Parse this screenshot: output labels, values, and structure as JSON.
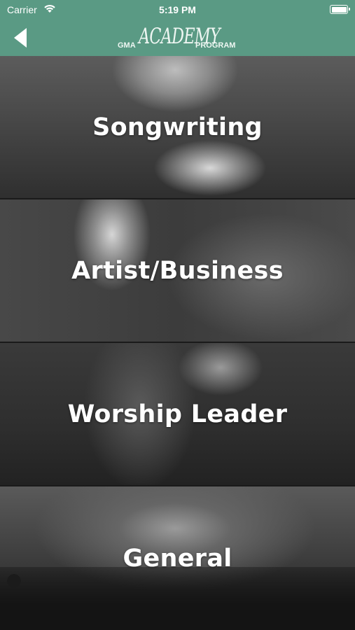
{
  "status_bar": {
    "carrier": "Carrier",
    "time": "5:19 PM"
  },
  "nav": {
    "logo": {
      "prefix": "GMA",
      "main": "ACADEMY",
      "suffix": "PROGRAM"
    }
  },
  "categories": [
    {
      "label": "Songwriting"
    },
    {
      "label": "Artist/Business"
    },
    {
      "label": "Worship Leader"
    },
    {
      "label": "General"
    }
  ],
  "colors": {
    "nav_background": "#5a9a84",
    "text": "#ffffff"
  },
  "icons": {
    "back": "back-arrow-icon",
    "wifi": "wifi-icon",
    "battery": "battery-icon"
  }
}
